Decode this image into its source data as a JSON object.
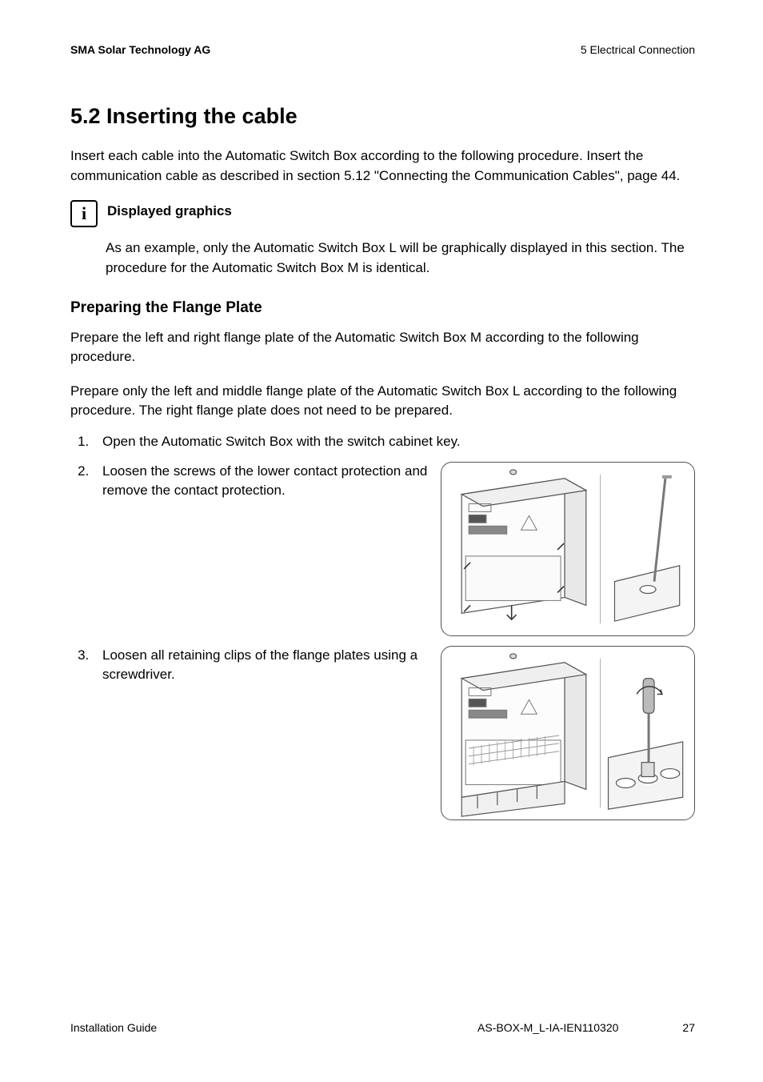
{
  "header": {
    "left": "SMA Solar Technology AG",
    "right": "5 Electrical Connection"
  },
  "section": {
    "number_title": "5.2  Inserting the cable",
    "intro": "Insert each cable into the Automatic Switch Box according to the following procedure. Insert the communication cable as described in section 5.12 \"Connecting the Communication Cables\", page 44."
  },
  "info": {
    "icon_glyph": "i",
    "title": "Displayed graphics",
    "body": "As an example, only the Automatic Switch Box L will be graphically displayed in this section. The procedure for the Automatic Switch Box M is identical."
  },
  "flange": {
    "heading": "Preparing the Flange Plate",
    "p1": "Prepare the left and right flange plate of the Automatic Switch Box M according to the following procedure.",
    "p2": "Prepare only the left and middle flange plate of the Automatic Switch Box L according to the following procedure. The right flange plate does not need to be prepared."
  },
  "steps": [
    {
      "text": "Open the Automatic Switch Box with the switch cabinet key.",
      "has_figure": false
    },
    {
      "text": "Loosen the screws of the lower contact protection and remove the contact protection.",
      "has_figure": true,
      "figure_name": "figure-contact-protection"
    },
    {
      "text": "Loosen all retaining clips of the flange plates using a screwdriver.",
      "has_figure": true,
      "figure_name": "figure-retaining-clips"
    }
  ],
  "footer": {
    "left": "Installation Guide",
    "mid": "AS-BOX-M_L-IA-IEN110320",
    "page": "27"
  }
}
